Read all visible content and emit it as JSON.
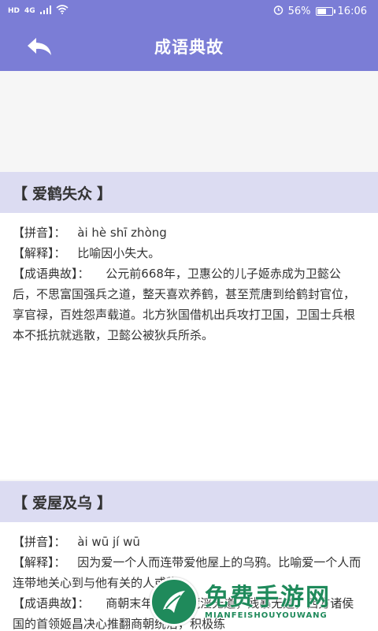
{
  "status_bar": {
    "network_small": "HD",
    "network_type": "4G",
    "battery_percent": "56%",
    "time": "16:06"
  },
  "app_bar": {
    "title": "成语典故"
  },
  "entries": [
    {
      "title": "爱鹤失众",
      "pinyin_label": "【拼音】：",
      "pinyin": "ài hè shī zhòng",
      "meaning_label": "【解释】：",
      "meaning": "比喻因小失大。",
      "story_label": "【成语典故】：",
      "story": "公元前668年，卫惠公的儿子姬赤成为卫懿公后，不思富国强兵之道，整天喜欢养鹤，甚至荒唐到给鹤封官位，享官禄，百姓怨声载道。北方狄国借机出兵攻打卫国，卫国士兵根本不抵抗就逃散，卫懿公被狄兵所杀。"
    },
    {
      "title": "爱屋及乌",
      "pinyin_label": "【拼音】：",
      "pinyin": "ài wū jí wū",
      "meaning_label": "【解释】：",
      "meaning": "因为爱一个人而连带爱他屋上的乌鸦。比喻爱一个人而连带地关心到与他有关的人或物。",
      "story_label": "【成语典故】：",
      "story": "商朝末年，纣王荒淫无道，残暴无道，西方诸侯国的首领姬昌决心推翻商朝统治，积极练"
    }
  ],
  "watermark": {
    "cn": "免费手游网",
    "en": "MIANFEISHOUYOUWANG"
  }
}
